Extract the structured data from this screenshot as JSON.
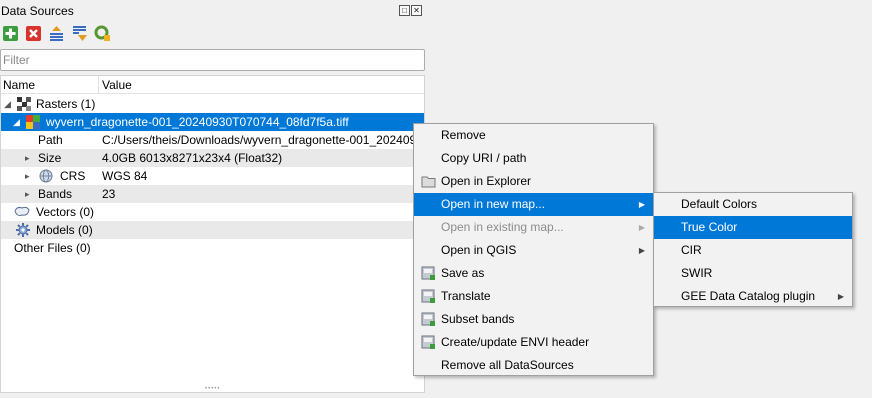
{
  "panel": {
    "title": "Data Sources",
    "filter_placeholder": "Filter",
    "columns": {
      "name": "Name",
      "value": "Value"
    }
  },
  "tree": {
    "rasters": "Rasters (1)",
    "file": "wyvern_dragonette-001_20240930T070744_08fd7f5a.tiff",
    "path_label": "Path",
    "path_value": "C:/Users/theis/Downloads/wyvern_dragonette-001_202409...",
    "size_label": "Size",
    "size_value": "4.0GB 6013x8271x23x4 (Float32)",
    "crs_label": "CRS",
    "crs_value": "WGS 84",
    "bands_label": "Bands",
    "bands_value": "23",
    "vectors": "Vectors (0)",
    "models": "Models (0)",
    "other": "Other Files (0)"
  },
  "context_menu": {
    "remove": "Remove",
    "copy_uri": "Copy URI / path",
    "open_explorer": "Open in Explorer",
    "open_new_map": "Open in new map...",
    "open_existing_map": "Open in existing map...",
    "open_qgis": "Open in QGIS",
    "save_as": "Save as",
    "translate": "Translate",
    "subset_bands": "Subset bands",
    "envi_header": "Create/update ENVI header",
    "remove_all": "Remove all DataSources"
  },
  "submenu": {
    "default_colors": "Default Colors",
    "true_color": "True Color",
    "cir": "CIR",
    "swir": "SWIR",
    "gee_plugin": "GEE Data Catalog plugin"
  },
  "colors": {
    "selection": "#0078d7",
    "menu_bg": "#f2f2f2"
  }
}
